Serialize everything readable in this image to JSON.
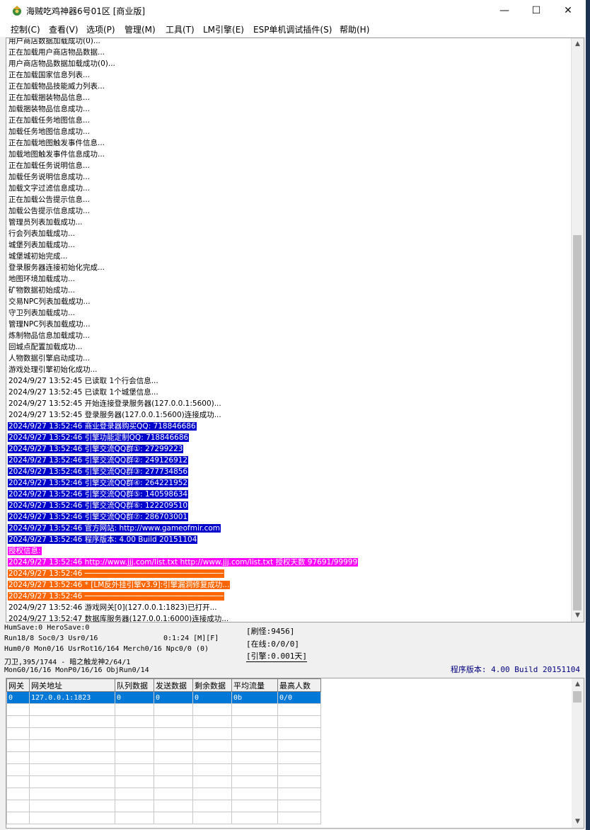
{
  "window": {
    "title": "海贼吃鸡神器6号01区 [商业版]",
    "controls": {
      "minimize": "—",
      "maximize": "☐",
      "close": "✕"
    }
  },
  "menu": [
    {
      "label": "控制(C)"
    },
    {
      "label": "查看(V)"
    },
    {
      "label": "选项(P)"
    },
    {
      "label": "管理(M)"
    },
    {
      "label": "工具(T)"
    },
    {
      "label": "LM引擎(E)"
    },
    {
      "label": "ESP单机调试插件(S)"
    },
    {
      "label": "帮助(H)"
    }
  ],
  "log": {
    "lines": [
      {
        "text": "用户商店数据加载成功(0)...",
        "style": "normal"
      },
      {
        "text": "正在加载用户商店物品数据...",
        "style": "normal"
      },
      {
        "text": "用户商店物品数据加载成功(0)...",
        "style": "normal"
      },
      {
        "text": "正在加载国家信息列表...",
        "style": "normal"
      },
      {
        "text": "正在加载物品技能威力列表...",
        "style": "normal"
      },
      {
        "text": "正在加载捆装物品信息...",
        "style": "normal"
      },
      {
        "text": "加载捆装物品信息成功...",
        "style": "normal"
      },
      {
        "text": "正在加载任务地图信息...",
        "style": "normal"
      },
      {
        "text": "加载任务地图信息成功...",
        "style": "normal"
      },
      {
        "text": "正在加载地图触发事件信息...",
        "style": "normal"
      },
      {
        "text": "加载地图触发事件信息成功...",
        "style": "normal"
      },
      {
        "text": "正在加载任务说明信息...",
        "style": "normal"
      },
      {
        "text": "加载任务说明信息成功...",
        "style": "normal"
      },
      {
        "text": "加载文字过滤信息成功...",
        "style": "normal"
      },
      {
        "text": "正在加载公告提示信息...",
        "style": "normal"
      },
      {
        "text": "加载公告提示信息成功...",
        "style": "normal"
      },
      {
        "text": "管理员列表加载成功...",
        "style": "normal"
      },
      {
        "text": "行会列表加载成功...",
        "style": "normal"
      },
      {
        "text": "城堡列表加载成功...",
        "style": "normal"
      },
      {
        "text": "城堡城初始完成...",
        "style": "normal"
      },
      {
        "text": "登录服务器连接初始化完成...",
        "style": "normal"
      },
      {
        "text": "地图环境加载成功...",
        "style": "normal"
      },
      {
        "text": "矿物数据初始成功...",
        "style": "normal"
      },
      {
        "text": "交易NPC列表加载成功...",
        "style": "normal"
      },
      {
        "text": "守卫列表加载成功...",
        "style": "normal"
      },
      {
        "text": "管理NPC列表加载成功...",
        "style": "normal"
      },
      {
        "text": "炼制物品信息加载成功...",
        "style": "normal"
      },
      {
        "text": "回城点配置加载成功...",
        "style": "normal"
      },
      {
        "text": "人物数据引擎启动成功...",
        "style": "normal"
      },
      {
        "text": "游戏处理引擎初始化成功...",
        "style": "normal"
      },
      {
        "text": "2024/9/27 13:52:45 已读取 1个行会信息...",
        "style": "normal"
      },
      {
        "text": "2024/9/27 13:52:45 已读取 1个城堡信息...",
        "style": "normal"
      },
      {
        "text": "2024/9/27 13:52:45 开始连接登录服务器(127.0.0.1:5600)...",
        "style": "normal"
      },
      {
        "text": "2024/9/27 13:52:45 登录服务器(127.0.0.1:5600)连接成功...",
        "style": "normal"
      },
      {
        "text": "2024/9/27 13:52:46 商业登录器购买QQ: 718846686",
        "style": "blue"
      },
      {
        "text": "2024/9/27 13:52:46 引擎功能定制QQ: 718846686",
        "style": "blue"
      },
      {
        "text": "2024/9/27 13:52:46 引擎交流QQ群①: 27299223",
        "style": "blue"
      },
      {
        "text": "2024/9/27 13:52:46 引擎交流QQ群②: 249126912",
        "style": "blue"
      },
      {
        "text": "2024/9/27 13:52:46 引擎交流QQ群③: 277734856",
        "style": "blue"
      },
      {
        "text": "2024/9/27 13:52:46 引擎交流QQ群④: 264221952",
        "style": "blue"
      },
      {
        "text": "2024/9/27 13:52:46 引擎交流QQ群⑤: 140598634",
        "style": "blue"
      },
      {
        "text": "2024/9/27 13:52:46 引擎交流QQ群⑥: 122209510",
        "style": "blue"
      },
      {
        "text": "2024/9/27 13:52:46 引擎交流QQ群⑦: 286703001",
        "style": "blue"
      },
      {
        "text": "2024/9/27 13:52:46 官方网站: http://www.gameofmir.com",
        "style": "blue"
      },
      {
        "text": "2024/9/27 13:52:46 程序版本: 4.00 Build 20151104",
        "style": "blue"
      },
      {
        "text": "授权信息:",
        "style": "magenta"
      },
      {
        "text": "2024/9/27 13:52:46 http://www.jjj.com/list.txt http://www.jjj.com/list.txt 授权天数 97691/99999",
        "style": "magenta"
      },
      {
        "text": "2024/9/27 13:52:46 ───────────────────────────────",
        "style": "orange"
      },
      {
        "text": "2024/9/27 13:52:46 * [LM反外挂引擎v3.9]:引擎漏洞修复成功...",
        "style": "orange"
      },
      {
        "text": "2024/9/27 13:52:46 ───────────────────────────────",
        "style": "orange"
      },
      {
        "text": "2024/9/27 13:52:46 游戏网关[0](127.0.0.1:1823)已打开...",
        "style": "normal"
      },
      {
        "text": "2024/9/27 13:52:47 数据库服务器(127.0.0.1:6000)连接成功...",
        "style": "normal"
      }
    ]
  },
  "status": {
    "line1": "HumSave:0 HeroSave:0",
    "line2": "Run18/8 Soc0/3 Usr0/16",
    "line2_time": "0:1:24 [M][F]",
    "line3": "Hum0/0 Mon0/16 UsrRot16/164 Merch0/16 Npc0/0 (0)",
    "line4": "刀卫,395/1744 - 暗之触龙神2/64/1",
    "line5": "MonG0/16/16 MonP0/16/16 ObjRun0/14",
    "refresh": "[刷怪:9456]",
    "online": "[在线:0/0/0]",
    "engine": "[引擎:0.001天]",
    "version": "程序版本: 4.00 Build 20151104"
  },
  "gateway_table": {
    "headers": [
      "网关",
      "网关地址",
      "队列数据",
      "发送数据",
      "剩余数据",
      "平均流量",
      "最高人数"
    ],
    "rows": [
      [
        "0",
        "127.0.0.1:1823",
        "0",
        "0",
        "0",
        "0b",
        "0/0"
      ]
    ]
  }
}
